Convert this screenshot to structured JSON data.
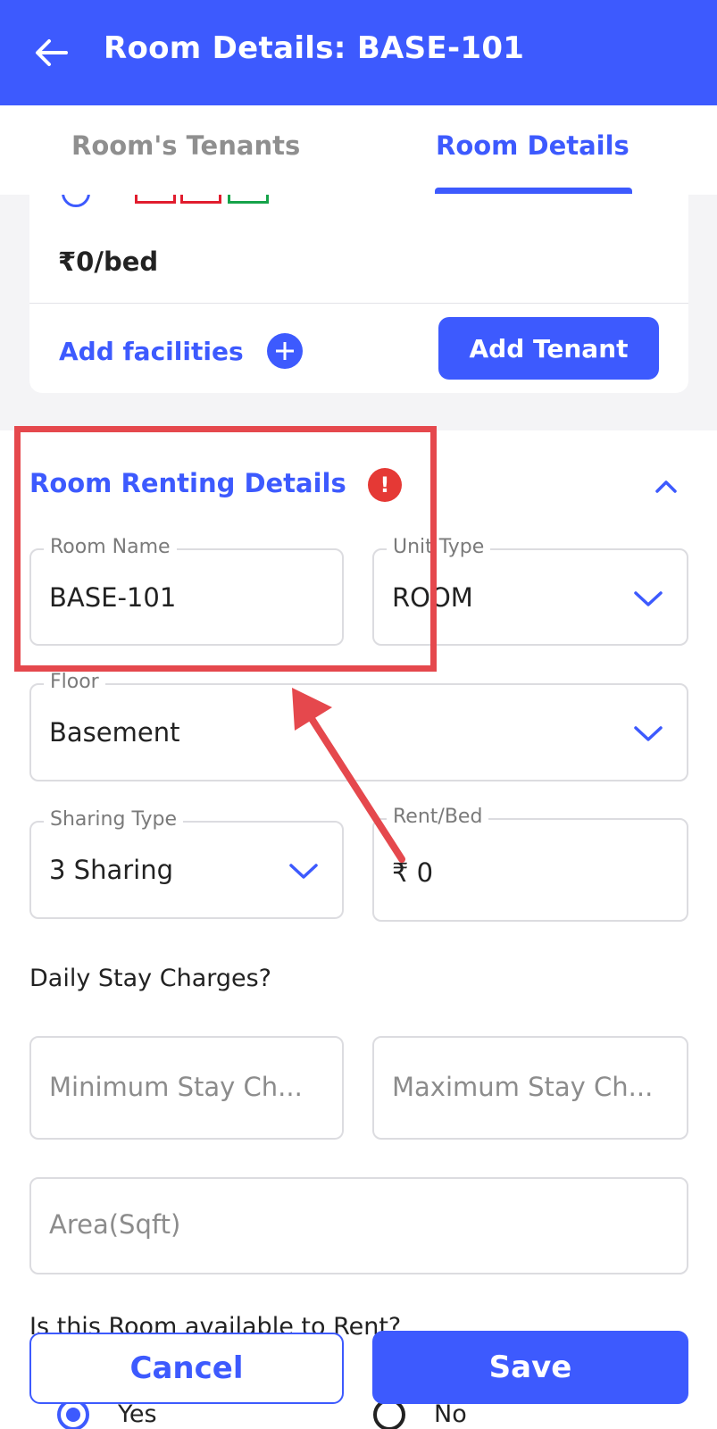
{
  "appbar": {
    "title": "Room Details: BASE-101"
  },
  "tabs": [
    {
      "label": "Room's Tenants",
      "active": false
    },
    {
      "label": "Room Details",
      "active": true
    }
  ],
  "room_card": {
    "per_bed": "₹0/bed",
    "add_facilities": "Add facilities",
    "add_tenant": "Add Tenant"
  },
  "section": {
    "title": "Room Renting Details",
    "warning": "!"
  },
  "fields": {
    "room_name": {
      "label": "Room Name",
      "value": "BASE-101"
    },
    "unit_type": {
      "label": "Unit Type",
      "value": "ROOM"
    },
    "floor": {
      "label": "Floor",
      "value": "Basement"
    },
    "sharing_type": {
      "label": "Sharing Type",
      "value": "3 Sharing"
    },
    "rent_bed": {
      "label": "Rent/Bed",
      "value": "₹ 0"
    }
  },
  "daily_stay": {
    "label": "Daily Stay Charges?",
    "min_placeholder": "Minimum Stay Ch...",
    "max_placeholder": "Maximum Stay Ch..."
  },
  "area": {
    "placeholder": "Area(Sqft)"
  },
  "availability": {
    "question": "Is this Room available to Rent?",
    "options": [
      {
        "label": "Yes",
        "selected": true
      },
      {
        "label": "No",
        "selected": false
      }
    ]
  },
  "footer": {
    "cancel": "Cancel",
    "save": "Save"
  },
  "colors": {
    "primary": "#3d5afe",
    "annotation": "#e5484d",
    "warning": "#e53935"
  }
}
